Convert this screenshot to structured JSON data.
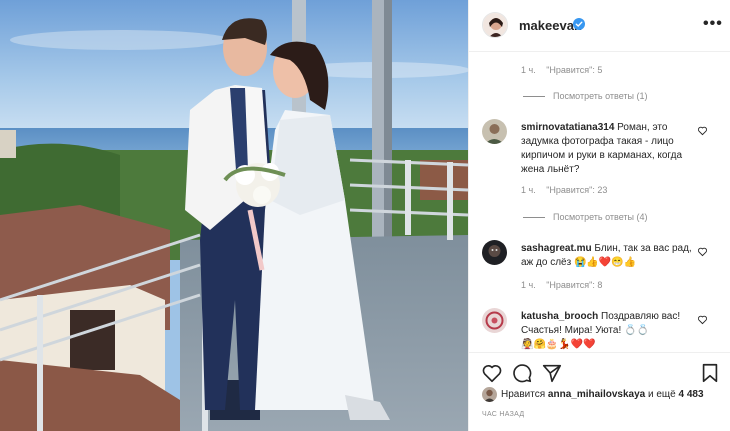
{
  "post": {
    "username": "makeevan",
    "more_label": "•••"
  },
  "comments_panel": {
    "first_meta": {
      "time": "1 ч.",
      "likes": "\"Нравится\": 5"
    },
    "first_replies": "Посмотреть ответы (1)",
    "items": [
      {
        "username": "smirnovatatiana314",
        "text": "Роман, это задумка фотографа такая - лицо кирпичом и руки в карманах, когда жена льнёт?",
        "time": "1 ч.",
        "likes": "\"Нравится\": 23",
        "replies": "Посмотреть ответы (4)"
      },
      {
        "username": "sashagreat.mu",
        "text": "Блин, так за вас рад, аж до слёз 😭👍❤️😁👍",
        "time": "1 ч.",
        "likes": "\"Нравится\": 8"
      },
      {
        "username": "katusha_brooch",
        "text": "Поздравляю вас! Счастья! Мира! Уюта! 💍💍",
        "emoji_line": "👰🤗🎂💃❤️❤️"
      }
    ]
  },
  "footer": {
    "likes_prefix": "Нравится",
    "likes_user": "anna_mihailovskaya",
    "likes_suffix": "и ещё",
    "likes_count": "4 483",
    "time_ago": "ЧАС НАЗАД"
  },
  "colors": {
    "verified": "#3897f0",
    "text": "#262626",
    "muted": "#8e8e8e",
    "border": "#efefef"
  },
  "icons": [
    "heart-icon",
    "comment-icon",
    "share-icon",
    "bookmark-icon",
    "verified-badge-icon",
    "more-options-icon"
  ]
}
